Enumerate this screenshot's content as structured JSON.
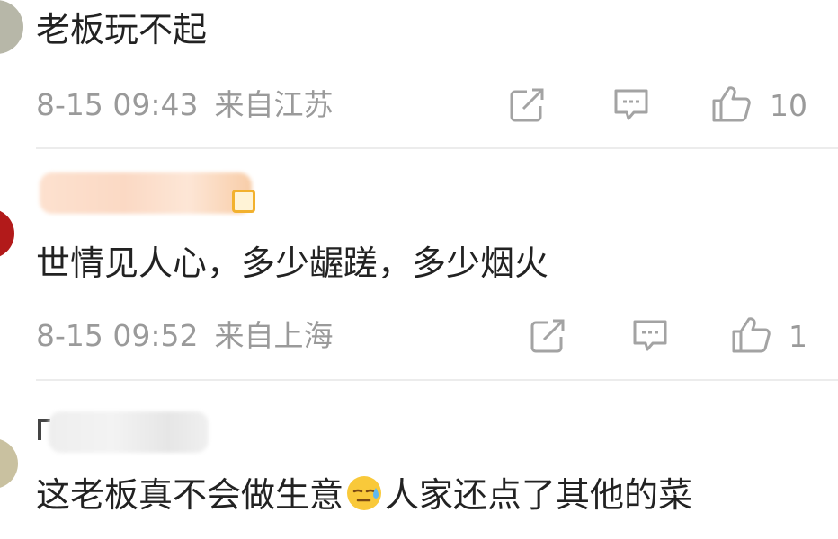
{
  "comments": [
    {
      "text": "老板玩不起",
      "time": "8-15 09:43",
      "location": "来自江苏",
      "likes": "10"
    },
    {
      "text": "世情见人心，多少龌蹉，多少烟火",
      "time": "8-15 09:52",
      "location": "来自上海",
      "likes": "1"
    },
    {
      "text_before": "这老板真不会做生意",
      "emoji": "sweat-smile-emoji",
      "text_after": "人家还点了其他的菜"
    }
  ],
  "colors": {
    "meta": "#9a9a9a",
    "text": "#222222",
    "divider": "#ececec"
  }
}
